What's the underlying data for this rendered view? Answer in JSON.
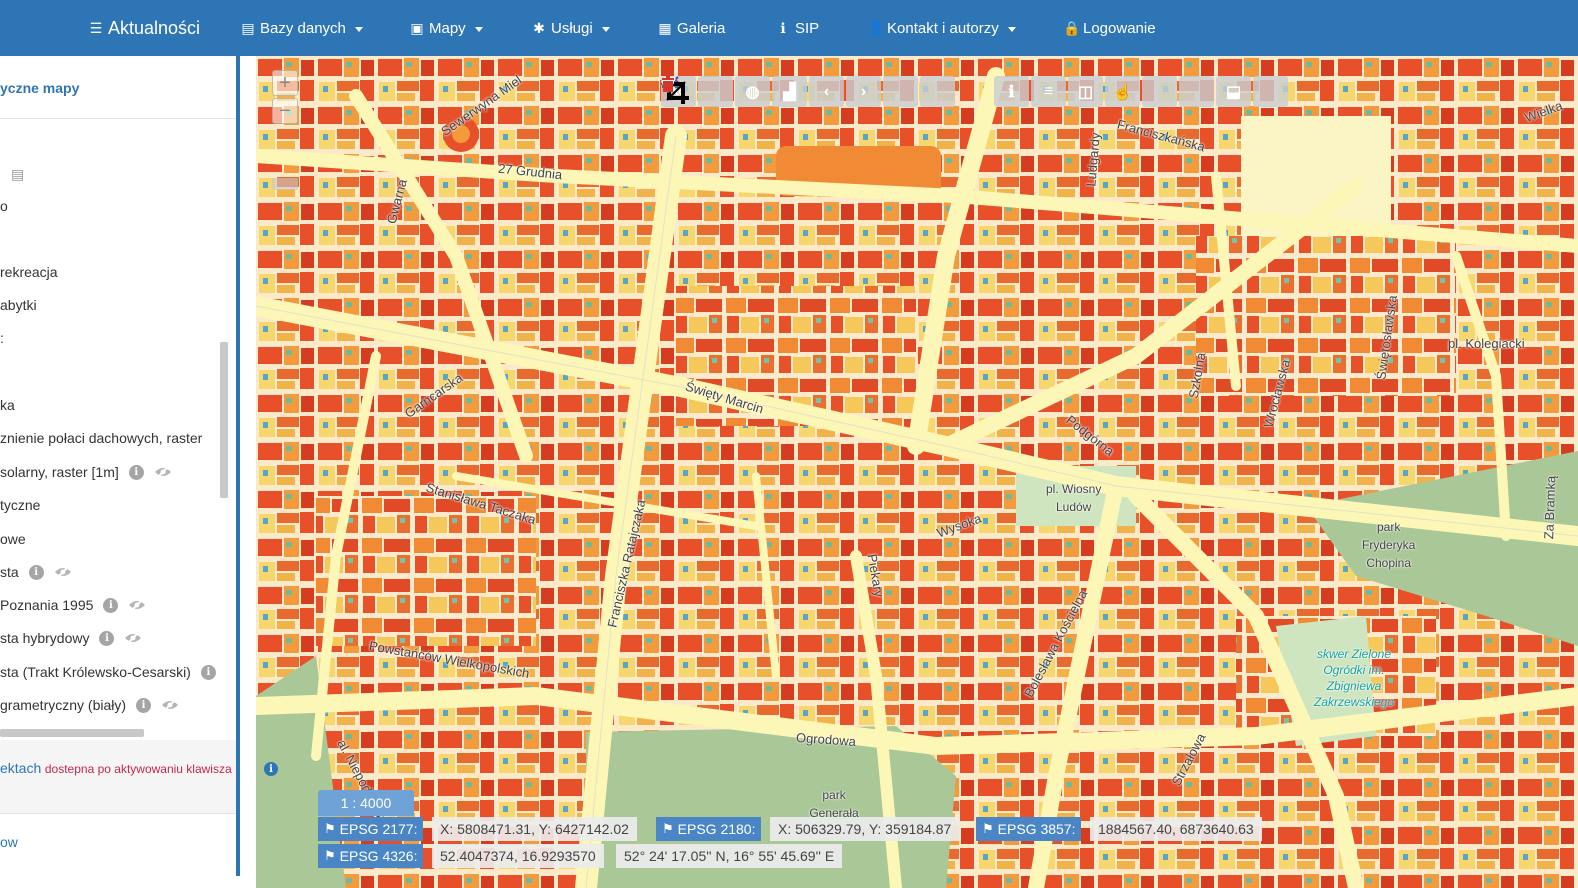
{
  "nav": {
    "brand": "Aktualności",
    "items": [
      {
        "icon": "database-icon",
        "glyph": "▤",
        "label": "Bazy danych",
        "caret": true
      },
      {
        "icon": "picture-icon",
        "glyph": "▣",
        "label": "Mapy",
        "caret": true
      },
      {
        "icon": "asterisk-icon",
        "glyph": "✱",
        "label": "Usługi",
        "caret": true
      },
      {
        "icon": "grid-icon",
        "glyph": "▦",
        "label": "Galeria",
        "caret": false
      },
      {
        "icon": "info-icon",
        "glyph": "ℹ",
        "label": "SIP",
        "caret": false
      },
      {
        "icon": "user-icon",
        "glyph": "👤",
        "label": "Kontakt i autorzy",
        "caret": true
      },
      {
        "icon": "lock-icon",
        "glyph": "🔒",
        "label": "Logowanie",
        "caret": false
      }
    ]
  },
  "sidebar": {
    "title": "yczne mapy",
    "layers": [
      {
        "label": "o",
        "info": false,
        "eye": false
      },
      {
        "label": "rekreacja",
        "info": false,
        "eye": false
      },
      {
        "label": "abytki",
        "info": false,
        "eye": false
      },
      {
        "label": ":",
        "info": false,
        "eye": false
      },
      {
        "label": "ka",
        "info": false,
        "eye": false
      },
      {
        "label": "znienie połaci dachowych, raster",
        "info": false,
        "eye": false
      },
      {
        "label": "solarny, raster [1m]",
        "info": true,
        "eye": true
      },
      {
        "label": "tyczne",
        "info": false,
        "eye": false
      },
      {
        "label": "owe",
        "info": false,
        "eye": false
      },
      {
        "label": "sta",
        "info": true,
        "eye": true
      },
      {
        "label": "Poznania 1995",
        "info": true,
        "eye": true
      },
      {
        "label": "sta hybrydowy",
        "info": true,
        "eye": true
      },
      {
        "label": "sta (Trakt Królewsko-Cesarski)",
        "info": true,
        "eye": false
      },
      {
        "label": "grametryczny (biały)",
        "info": true,
        "eye": true
      }
    ],
    "info_text_blue": "ektach",
    "info_text_red": "dostepna po aktywowaniu klawisza",
    "bottom_link": "ow"
  },
  "map": {
    "scale": "1 : 4000",
    "coords": [
      {
        "tag": "EPSG 2177:",
        "value": "X: 5808471.31, Y: 6427142.02"
      },
      {
        "tag": "EPSG 2180:",
        "value": "X: 506329.79, Y: 359184.87"
      },
      {
        "tag": "EPSG 3857:",
        "value": "1884567.40, 6873640.63"
      },
      {
        "tag": "EPSG 4326:",
        "value": "52.4047374, 16.9293570"
      }
    ],
    "dms": "52° 24' 17.05'' N, 16° 55' 45.69'' E",
    "labels": {
      "st1": "Sewerwyna Miel",
      "st2": "27 Grudnia",
      "st3": "Gwarna",
      "st4": "Franciszkańska",
      "st5": "Święty Marcin",
      "st6": "Garncarska",
      "st7": "Stanisława Taczaka",
      "st8": "Franciszka Ratajczaka",
      "st9": "Powstańców Wielkopolskich",
      "st10": "Ogrodowa",
      "st11": "Piekary",
      "st12": "Wysoka",
      "st13": "Podgórna",
      "st14": "Szkolna",
      "st15": "Wrocławska",
      "st16": "Świętosławska",
      "st17": "Bolesława Kościelna",
      "st18": "Strzałowa",
      "st19": "Za Bramką",
      "st20": "Wielka",
      "st21": "Ludgardy",
      "st22": "pl. Kolegiacki",
      "st23": "al. Niepodległości",
      "sq1": "pl. Wiosny\nLudów",
      "sq2": "park\nFryderyka\nChopina",
      "sq3": "park\nGenerała\nDąbrowskiego",
      "sq4": "skwer Zielone\nOgródki im.\nZbigniewa\nZakrzewskiego"
    }
  },
  "colors": {
    "nav_bg": "#2e75b6",
    "building_hot": "#e8502a",
    "building_warm": "#f29a3c",
    "building_cool": "#f5d76e",
    "road": "#fdf7b7",
    "park": "#a9c797"
  }
}
